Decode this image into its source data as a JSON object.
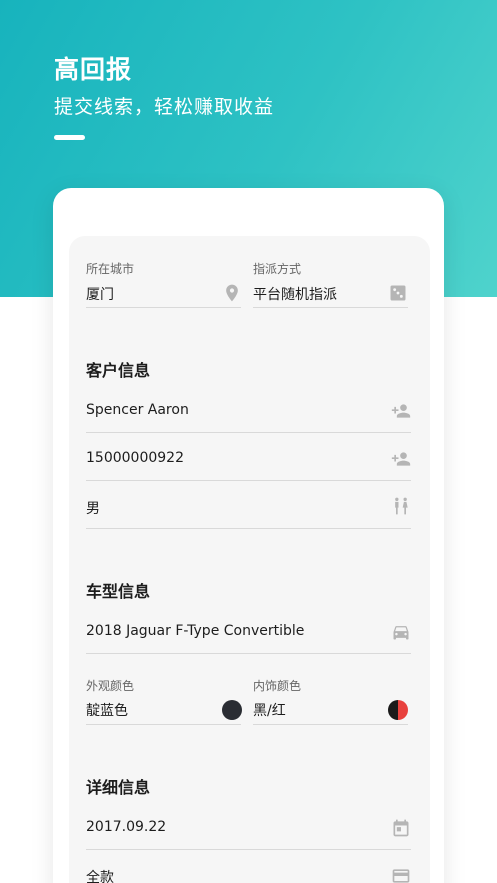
{
  "hero": {
    "title": "高回报",
    "subtitle": "提交线索，轻松赚取收益"
  },
  "dispatch": {
    "city_label": "所在城市",
    "city_value": "厦门",
    "method_label": "指派方式",
    "method_value": "平台随机指派"
  },
  "customer": {
    "section_title": "客户信息",
    "name": "Spencer Aaron",
    "phone": "15000000922",
    "gender": "男"
  },
  "vehicle": {
    "section_title": "车型信息",
    "model": "2018 Jaguar F-Type Convertible",
    "exterior_label": "外观颜色",
    "exterior_value": "靛蓝色",
    "interior_label": "内饰颜色",
    "interior_value": "黑/红",
    "colors": {
      "exterior": "#2a2d33",
      "interior_left": "#1a1a1a",
      "interior_right": "#e8413d"
    }
  },
  "details": {
    "section_title": "详细信息",
    "date": "2017.09.22",
    "payment": "全款"
  },
  "icons": {
    "city": "location-pin-icon",
    "method": "dice-icon",
    "name": "add-person-icon",
    "phone": "add-person-icon",
    "gender": "wc-people-icon",
    "model": "car-icon",
    "date": "calendar-icon",
    "payment": "credit-card-icon"
  },
  "theme": {
    "accent": "#2ec2c4",
    "icon_gray": "#b5b5b5"
  }
}
